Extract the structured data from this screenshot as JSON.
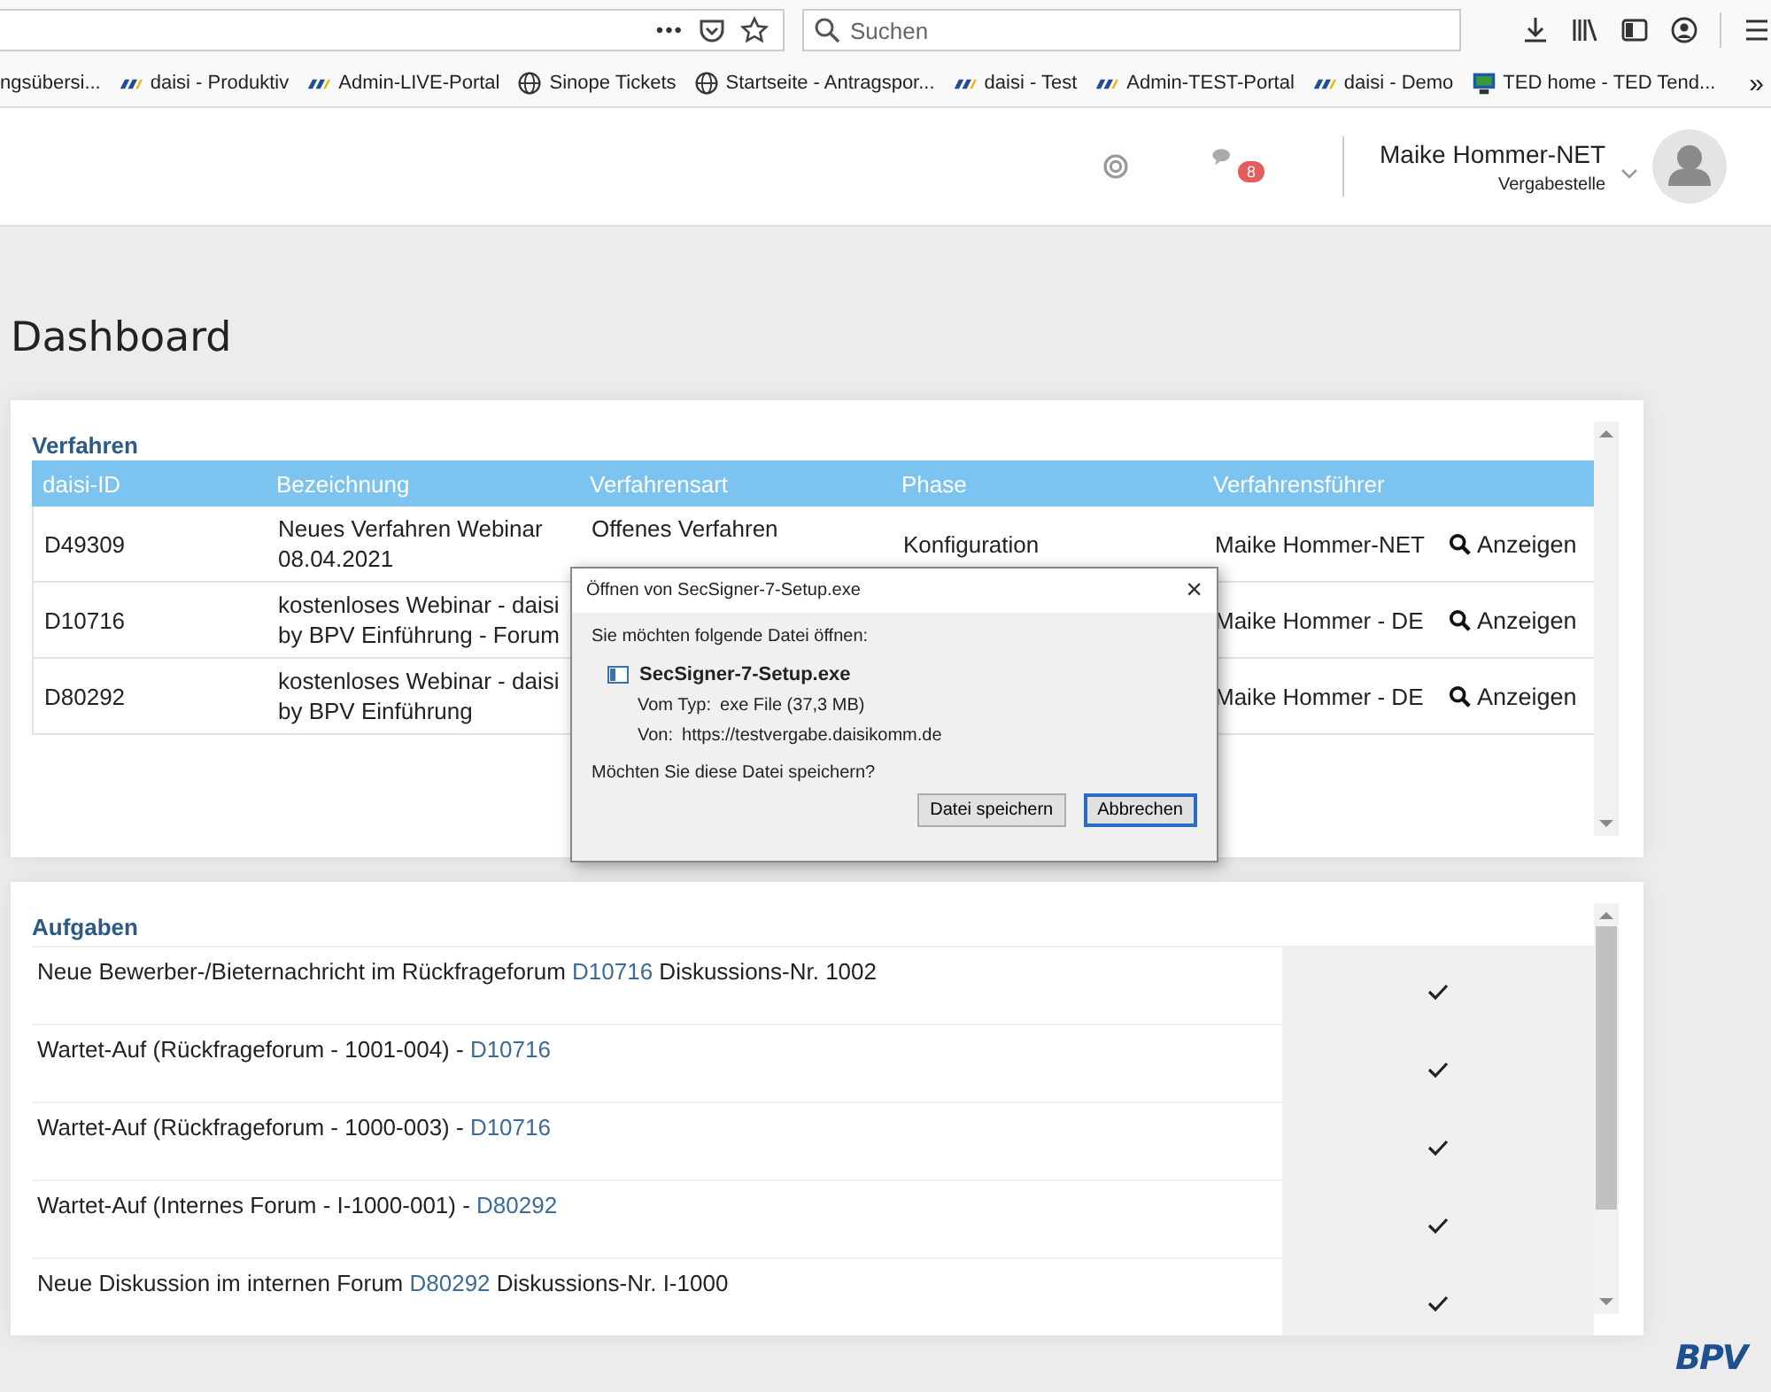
{
  "browser": {
    "more": "•••",
    "search_placeholder": "Suchen"
  },
  "bookmarks": [
    {
      "label": "ngsübersi...",
      "kind": "plain"
    },
    {
      "label": "daisi - Produktiv",
      "kind": "bpv"
    },
    {
      "label": "Admin-LIVE-Portal",
      "kind": "bpv"
    },
    {
      "label": "Sinope Tickets",
      "kind": "globe"
    },
    {
      "label": "Startseite - Antragspor...",
      "kind": "globe"
    },
    {
      "label": "daisi - Test",
      "kind": "bpv"
    },
    {
      "label": "Admin-TEST-Portal",
      "kind": "bpv"
    },
    {
      "label": "daisi - Demo",
      "kind": "bpv"
    },
    {
      "label": "TED home - TED Tend...",
      "kind": "ted"
    }
  ],
  "bookmarks_overflow": "»",
  "header": {
    "notification_count": "8",
    "user_name": "Maike Hommer-NET",
    "user_role": "Vergabestelle"
  },
  "page_title": "Dashboard",
  "procedures": {
    "title": "Verfahren",
    "columns": [
      "daisi-ID",
      "Bezeichnung",
      "Verfahrensart",
      "Phase",
      "Verfahrensführer"
    ],
    "rows": [
      {
        "id": "D49309",
        "name": "Neues Verfahren Webinar 08.04.2021",
        "type": "Offenes Verfahren",
        "phase": "Konfiguration",
        "lead": "Maike Hommer-NET",
        "action": "Anzeigen"
      },
      {
        "id": "D10716",
        "name": "kostenloses Webinar - daisi by BPV Einführung - Forum",
        "lead": "Maike Hommer - DE",
        "action": "Anzeigen"
      },
      {
        "id": "D80292",
        "name": "kostenloses Webinar - daisi by BPV Einführung",
        "lead": "Maike Hommer - DE",
        "action": "Anzeigen"
      }
    ]
  },
  "tasks": {
    "title": "Aufgaben",
    "rows": [
      {
        "before": "Neue Bewerber-/Bieternachricht im Rückfrageforum ",
        "link": "D10716",
        "after": " Diskussions-Nr. 1002"
      },
      {
        "before": "Wartet-Auf (Rückfrageforum - 1001-004) - ",
        "link": "D10716",
        "after": ""
      },
      {
        "before": "Wartet-Auf (Rückfrageforum - 1000-003) - ",
        "link": "D10716",
        "after": ""
      },
      {
        "before": "Wartet-Auf (Internes Forum - I-1000-001) - ",
        "link": "D80292",
        "after": ""
      },
      {
        "before": "Neue Diskussion im internen Forum ",
        "link": "D80292",
        "after": " Diskussions-Nr. I-1000"
      }
    ]
  },
  "dialog": {
    "title": "Öffnen von SecSigner-7-Setup.exe",
    "close": "×",
    "intro": "Sie möchten folgende Datei öffnen:",
    "file_name": "SecSigner-7-Setup.exe",
    "type_label": "Vom Typ:",
    "type_value": "exe File (37,3 MB)",
    "from_label": "Von:",
    "from_value": "https://testvergabe.daisikomm.de",
    "question": "Möchten Sie diese Datei speichern?",
    "buttons": [
      "Datei speichern",
      "Abbrechen"
    ]
  },
  "logo": "BPV"
}
